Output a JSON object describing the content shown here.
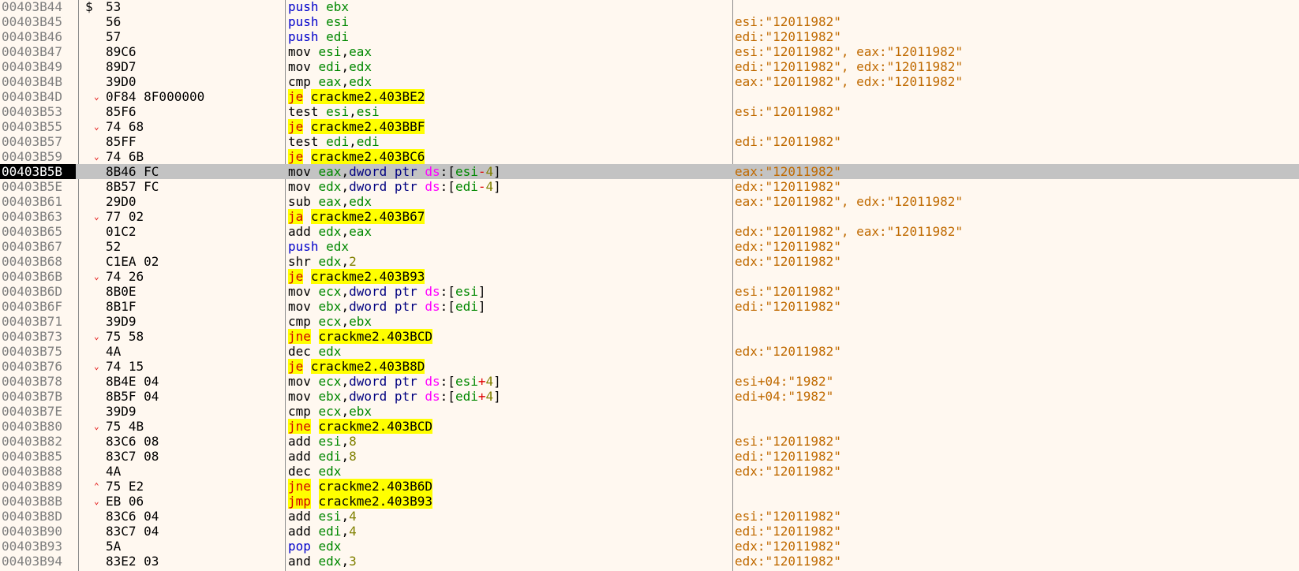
{
  "panel": {
    "name": "CPU disassembly"
  },
  "colors": {
    "background": "#fff8f0",
    "selected_row": "#c3c3c3",
    "address_selected_bg": "#000000",
    "jump_highlight": "#ffff00",
    "comment": "#c06a00",
    "register": "#008800",
    "stack_op": "#0000cc"
  },
  "rows": [
    {
      "address": "00403B44",
      "marker": "$",
      "arrow": "",
      "bytes": "53",
      "asm": [
        [
          "push",
          "pp"
        ],
        [
          " ebx",
          "reg"
        ]
      ],
      "jump": false,
      "comment": ""
    },
    {
      "address": "00403B45",
      "marker": "",
      "arrow": "",
      "bytes": "56",
      "asm": [
        [
          "push",
          "pp"
        ],
        [
          " esi",
          "reg"
        ]
      ],
      "jump": false,
      "comment": "esi:\"12011982\""
    },
    {
      "address": "00403B46",
      "marker": "",
      "arrow": "",
      "bytes": "57",
      "asm": [
        [
          "push",
          "pp"
        ],
        [
          " edi",
          "reg"
        ]
      ],
      "jump": false,
      "comment": "edi:\"12011982\""
    },
    {
      "address": "00403B47",
      "marker": "",
      "arrow": "",
      "bytes": "89C6",
      "asm": [
        [
          "mov ",
          "mn"
        ],
        [
          "esi",
          "reg"
        ],
        [
          ",",
          "plain"
        ],
        [
          "eax",
          "reg"
        ]
      ],
      "jump": false,
      "comment": "esi:\"12011982\", eax:\"12011982\""
    },
    {
      "address": "00403B49",
      "marker": "",
      "arrow": "",
      "bytes": "89D7",
      "asm": [
        [
          "mov ",
          "mn"
        ],
        [
          "edi",
          "reg"
        ],
        [
          ",",
          "plain"
        ],
        [
          "edx",
          "reg"
        ]
      ],
      "jump": false,
      "comment": "edi:\"12011982\", edx:\"12011982\""
    },
    {
      "address": "00403B4B",
      "marker": "",
      "arrow": "",
      "bytes": "39D0",
      "asm": [
        [
          "cmp ",
          "mn"
        ],
        [
          "eax",
          "reg"
        ],
        [
          ",",
          "plain"
        ],
        [
          "edx",
          "reg"
        ]
      ],
      "jump": false,
      "comment": "eax:\"12011982\", edx:\"12011982\""
    },
    {
      "address": "00403B4D",
      "marker": "",
      "arrow": "⌄",
      "bytes": "0F84 8F000000",
      "asm": [
        [
          "je",
          "jmn"
        ],
        [
          " ",
          "plain"
        ],
        [
          "crackme2.403BE2",
          "lbl"
        ]
      ],
      "jump": true,
      "comment": ""
    },
    {
      "address": "00403B53",
      "marker": "",
      "arrow": "",
      "bytes": "85F6",
      "asm": [
        [
          "test ",
          "mn"
        ],
        [
          "esi",
          "reg"
        ],
        [
          ",",
          "plain"
        ],
        [
          "esi",
          "reg"
        ]
      ],
      "jump": false,
      "comment": "esi:\"12011982\""
    },
    {
      "address": "00403B55",
      "marker": "",
      "arrow": "⌄",
      "bytes": "74 68",
      "asm": [
        [
          "je",
          "jmn"
        ],
        [
          " ",
          "plain"
        ],
        [
          "crackme2.403BBF",
          "lbl"
        ]
      ],
      "jump": true,
      "comment": ""
    },
    {
      "address": "00403B57",
      "marker": "",
      "arrow": "",
      "bytes": "85FF",
      "asm": [
        [
          "test ",
          "mn"
        ],
        [
          "edi",
          "reg"
        ],
        [
          ",",
          "plain"
        ],
        [
          "edi",
          "reg"
        ]
      ],
      "jump": false,
      "comment": "edi:\"12011982\""
    },
    {
      "address": "00403B59",
      "marker": "",
      "arrow": "⌄",
      "bytes": "74 6B",
      "asm": [
        [
          "je",
          "jmn"
        ],
        [
          " ",
          "plain"
        ],
        [
          "crackme2.403BC6",
          "lbl"
        ]
      ],
      "jump": true,
      "comment": ""
    },
    {
      "address": "00403B5B",
      "marker": "",
      "arrow": "",
      "bytes": "8B46 FC",
      "asm": [
        [
          "mov ",
          "mn"
        ],
        [
          "eax",
          "reg"
        ],
        [
          ",",
          "plain"
        ],
        [
          "dword ptr ",
          "kw"
        ],
        [
          "ds",
          "seg"
        ],
        [
          ":[",
          "br"
        ],
        [
          "esi",
          "reg"
        ],
        [
          "-",
          "op"
        ],
        [
          "4",
          "num"
        ],
        [
          "]",
          "br"
        ]
      ],
      "jump": false,
      "comment": "eax:\"12011982\"",
      "selected": true
    },
    {
      "address": "00403B5E",
      "marker": "",
      "arrow": "",
      "bytes": "8B57 FC",
      "asm": [
        [
          "mov ",
          "mn"
        ],
        [
          "edx",
          "reg"
        ],
        [
          ",",
          "plain"
        ],
        [
          "dword ptr ",
          "kw"
        ],
        [
          "ds",
          "seg"
        ],
        [
          ":[",
          "br"
        ],
        [
          "edi",
          "reg"
        ],
        [
          "-",
          "op"
        ],
        [
          "4",
          "num"
        ],
        [
          "]",
          "br"
        ]
      ],
      "jump": false,
      "comment": "edx:\"12011982\""
    },
    {
      "address": "00403B61",
      "marker": "",
      "arrow": "",
      "bytes": "29D0",
      "asm": [
        [
          "sub ",
          "mn"
        ],
        [
          "eax",
          "reg"
        ],
        [
          ",",
          "plain"
        ],
        [
          "edx",
          "reg"
        ]
      ],
      "jump": false,
      "comment": "eax:\"12011982\", edx:\"12011982\""
    },
    {
      "address": "00403B63",
      "marker": "",
      "arrow": "⌄",
      "bytes": "77 02",
      "asm": [
        [
          "ja",
          "jmn"
        ],
        [
          " ",
          "plain"
        ],
        [
          "crackme2.403B67",
          "lbl"
        ]
      ],
      "jump": true,
      "comment": ""
    },
    {
      "address": "00403B65",
      "marker": "",
      "arrow": "",
      "bytes": "01C2",
      "asm": [
        [
          "add ",
          "mn"
        ],
        [
          "edx",
          "reg"
        ],
        [
          ",",
          "plain"
        ],
        [
          "eax",
          "reg"
        ]
      ],
      "jump": false,
      "comment": "edx:\"12011982\", eax:\"12011982\""
    },
    {
      "address": "00403B67",
      "marker": "",
      "arrow": "",
      "bytes": "52",
      "asm": [
        [
          "push",
          "pp"
        ],
        [
          " edx",
          "reg"
        ]
      ],
      "jump": false,
      "comment": "edx:\"12011982\""
    },
    {
      "address": "00403B68",
      "marker": "",
      "arrow": "",
      "bytes": "C1EA 02",
      "asm": [
        [
          "shr ",
          "mn"
        ],
        [
          "edx",
          "reg"
        ],
        [
          ",",
          "plain"
        ],
        [
          "2",
          "num"
        ]
      ],
      "jump": false,
      "comment": "edx:\"12011982\""
    },
    {
      "address": "00403B6B",
      "marker": "",
      "arrow": "⌄",
      "bytes": "74 26",
      "asm": [
        [
          "je",
          "jmn"
        ],
        [
          " ",
          "plain"
        ],
        [
          "crackme2.403B93",
          "lbl"
        ]
      ],
      "jump": true,
      "comment": ""
    },
    {
      "address": "00403B6D",
      "marker": "",
      "arrow": "",
      "bytes": "8B0E",
      "asm": [
        [
          "mov ",
          "mn"
        ],
        [
          "ecx",
          "reg"
        ],
        [
          ",",
          "plain"
        ],
        [
          "dword ptr ",
          "kw"
        ],
        [
          "ds",
          "seg"
        ],
        [
          ":[",
          "br"
        ],
        [
          "esi",
          "reg"
        ],
        [
          "]",
          "br"
        ]
      ],
      "jump": false,
      "comment": "esi:\"12011982\""
    },
    {
      "address": "00403B6F",
      "marker": "",
      "arrow": "",
      "bytes": "8B1F",
      "asm": [
        [
          "mov ",
          "mn"
        ],
        [
          "ebx",
          "reg"
        ],
        [
          ",",
          "plain"
        ],
        [
          "dword ptr ",
          "kw"
        ],
        [
          "ds",
          "seg"
        ],
        [
          ":[",
          "br"
        ],
        [
          "edi",
          "reg"
        ],
        [
          "]",
          "br"
        ]
      ],
      "jump": false,
      "comment": "edi:\"12011982\""
    },
    {
      "address": "00403B71",
      "marker": "",
      "arrow": "",
      "bytes": "39D9",
      "asm": [
        [
          "cmp ",
          "mn"
        ],
        [
          "ecx",
          "reg"
        ],
        [
          ",",
          "plain"
        ],
        [
          "ebx",
          "reg"
        ]
      ],
      "jump": false,
      "comment": ""
    },
    {
      "address": "00403B73",
      "marker": "",
      "arrow": "⌄",
      "bytes": "75 58",
      "asm": [
        [
          "jne",
          "jmn"
        ],
        [
          " ",
          "plain"
        ],
        [
          "crackme2.403BCD",
          "lbl"
        ]
      ],
      "jump": true,
      "comment": ""
    },
    {
      "address": "00403B75",
      "marker": "",
      "arrow": "",
      "bytes": "4A",
      "asm": [
        [
          "dec ",
          "mn"
        ],
        [
          "edx",
          "reg"
        ]
      ],
      "jump": false,
      "comment": "edx:\"12011982\""
    },
    {
      "address": "00403B76",
      "marker": "",
      "arrow": "⌄",
      "bytes": "74 15",
      "asm": [
        [
          "je",
          "jmn"
        ],
        [
          " ",
          "plain"
        ],
        [
          "crackme2.403B8D",
          "lbl"
        ]
      ],
      "jump": true,
      "comment": ""
    },
    {
      "address": "00403B78",
      "marker": "",
      "arrow": "",
      "bytes": "8B4E 04",
      "asm": [
        [
          "mov ",
          "mn"
        ],
        [
          "ecx",
          "reg"
        ],
        [
          ",",
          "plain"
        ],
        [
          "dword ptr ",
          "kw"
        ],
        [
          "ds",
          "seg"
        ],
        [
          ":[",
          "br"
        ],
        [
          "esi",
          "reg"
        ],
        [
          "+",
          "op"
        ],
        [
          "4",
          "num"
        ],
        [
          "]",
          "br"
        ]
      ],
      "jump": false,
      "comment": "esi+04:\"1982\""
    },
    {
      "address": "00403B7B",
      "marker": "",
      "arrow": "",
      "bytes": "8B5F 04",
      "asm": [
        [
          "mov ",
          "mn"
        ],
        [
          "ebx",
          "reg"
        ],
        [
          ",",
          "plain"
        ],
        [
          "dword ptr ",
          "kw"
        ],
        [
          "ds",
          "seg"
        ],
        [
          ":[",
          "br"
        ],
        [
          "edi",
          "reg"
        ],
        [
          "+",
          "op"
        ],
        [
          "4",
          "num"
        ],
        [
          "]",
          "br"
        ]
      ],
      "jump": false,
      "comment": "edi+04:\"1982\""
    },
    {
      "address": "00403B7E",
      "marker": "",
      "arrow": "",
      "bytes": "39D9",
      "asm": [
        [
          "cmp ",
          "mn"
        ],
        [
          "ecx",
          "reg"
        ],
        [
          ",",
          "plain"
        ],
        [
          "ebx",
          "reg"
        ]
      ],
      "jump": false,
      "comment": ""
    },
    {
      "address": "00403B80",
      "marker": "",
      "arrow": "⌄",
      "bytes": "75 4B",
      "asm": [
        [
          "jne",
          "jmn"
        ],
        [
          " ",
          "plain"
        ],
        [
          "crackme2.403BCD",
          "lbl"
        ]
      ],
      "jump": true,
      "comment": ""
    },
    {
      "address": "00403B82",
      "marker": "",
      "arrow": "",
      "bytes": "83C6 08",
      "asm": [
        [
          "add ",
          "mn"
        ],
        [
          "esi",
          "reg"
        ],
        [
          ",",
          "plain"
        ],
        [
          "8",
          "num"
        ]
      ],
      "jump": false,
      "comment": "esi:\"12011982\""
    },
    {
      "address": "00403B85",
      "marker": "",
      "arrow": "",
      "bytes": "83C7 08",
      "asm": [
        [
          "add ",
          "mn"
        ],
        [
          "edi",
          "reg"
        ],
        [
          ",",
          "plain"
        ],
        [
          "8",
          "num"
        ]
      ],
      "jump": false,
      "comment": "edi:\"12011982\""
    },
    {
      "address": "00403B88",
      "marker": "",
      "arrow": "",
      "bytes": "4A",
      "asm": [
        [
          "dec ",
          "mn"
        ],
        [
          "edx",
          "reg"
        ]
      ],
      "jump": false,
      "comment": "edx:\"12011982\""
    },
    {
      "address": "00403B89",
      "marker": "",
      "arrow": "⌃",
      "bytes": "75 E2",
      "asm": [
        [
          "jne",
          "jmn"
        ],
        [
          " ",
          "plain"
        ],
        [
          "crackme2.403B6D",
          "lbl"
        ]
      ],
      "jump": true,
      "comment": ""
    },
    {
      "address": "00403B8B",
      "marker": "",
      "arrow": "⌄",
      "bytes": "EB 06",
      "asm": [
        [
          "jmp",
          "jmn"
        ],
        [
          " ",
          "plain"
        ],
        [
          "crackme2.403B93",
          "lbl"
        ]
      ],
      "jump": true,
      "comment": ""
    },
    {
      "address": "00403B8D",
      "marker": "",
      "arrow": "",
      "bytes": "83C6 04",
      "asm": [
        [
          "add ",
          "mn"
        ],
        [
          "esi",
          "reg"
        ],
        [
          ",",
          "plain"
        ],
        [
          "4",
          "num"
        ]
      ],
      "jump": false,
      "comment": "esi:\"12011982\""
    },
    {
      "address": "00403B90",
      "marker": "",
      "arrow": "",
      "bytes": "83C7 04",
      "asm": [
        [
          "add ",
          "mn"
        ],
        [
          "edi",
          "reg"
        ],
        [
          ",",
          "plain"
        ],
        [
          "4",
          "num"
        ]
      ],
      "jump": false,
      "comment": "edi:\"12011982\""
    },
    {
      "address": "00403B93",
      "marker": "",
      "arrow": "",
      "bytes": "5A",
      "asm": [
        [
          "pop",
          "pp"
        ],
        [
          " edx",
          "reg"
        ]
      ],
      "jump": false,
      "comment": "edx:\"12011982\""
    },
    {
      "address": "00403B94",
      "marker": "",
      "arrow": "",
      "bytes": "83E2 03",
      "asm": [
        [
          "and ",
          "mn"
        ],
        [
          "edx",
          "reg"
        ],
        [
          ",",
          "plain"
        ],
        [
          "3",
          "num"
        ]
      ],
      "jump": false,
      "comment": "edx:\"12011982\""
    }
  ]
}
